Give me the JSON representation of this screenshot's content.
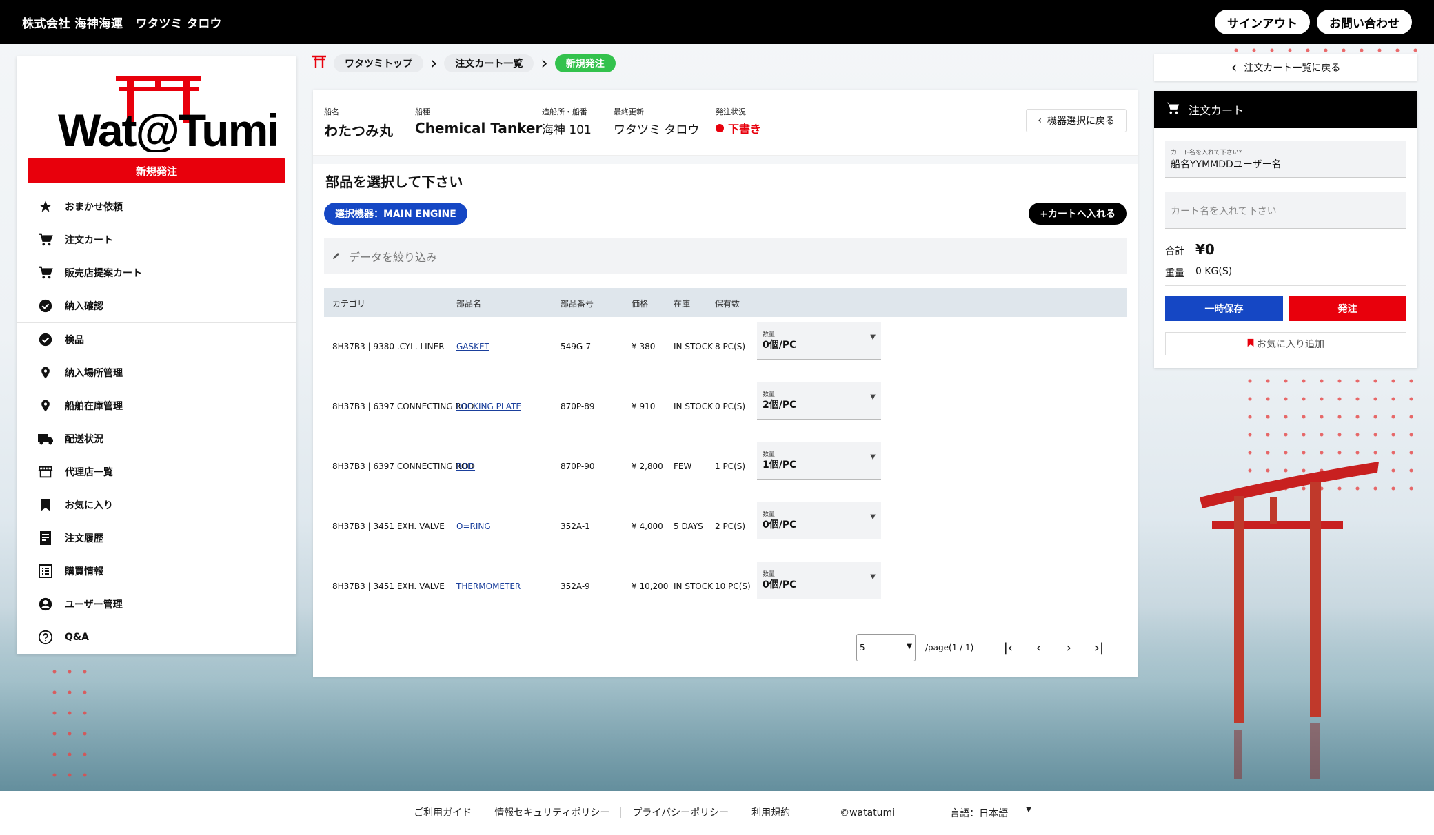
{
  "header": {
    "company": "株式会社 海神海運",
    "user": "ワタツミ タロウ",
    "signout_label": "サインアウト",
    "contact_label": "お問い合わせ"
  },
  "sidebar": {
    "new_order_label": "新規発注",
    "items": [
      {
        "label": "おまかせ依頼",
        "icon": "star-icon"
      },
      {
        "label": "注文カート",
        "icon": "cart-icon"
      },
      {
        "label": "販売店提案カート",
        "icon": "cart-icon"
      },
      {
        "label": "納入確認",
        "icon": "check-circle-icon"
      },
      {
        "label": "検品",
        "icon": "check-circle-icon"
      },
      {
        "label": "納入場所管理",
        "icon": "location-pin-icon"
      },
      {
        "label": "船舶在庫管理",
        "icon": "location-pin-icon"
      },
      {
        "label": "配送状況",
        "icon": "truck-icon"
      },
      {
        "label": "代理店一覧",
        "icon": "store-icon"
      },
      {
        "label": "お気に入り",
        "icon": "bookmark-icon"
      },
      {
        "label": "注文履歴",
        "icon": "receipt-icon"
      },
      {
        "label": "購買情報",
        "icon": "list-icon"
      },
      {
        "label": "ユーザー管理",
        "icon": "user-circle-icon"
      },
      {
        "label": "Q&A",
        "icon": "help-circle-icon"
      }
    ]
  },
  "breadcrumb": {
    "home": "ワタツミトップ",
    "cart_list": "注文カート一覧",
    "current": "新規発注"
  },
  "ship": {
    "name_label": "船名",
    "name": "わたつみ丸",
    "type_label": "船種",
    "type": "Chemical Tanker",
    "yard_label": "造船所・船番",
    "yard": "海神 101",
    "updated_label": "最終更新",
    "updated": "ワタツミ タロウ",
    "status_label": "発注状況",
    "status": "下書き",
    "back_label": "機器選択に戻る"
  },
  "parts": {
    "title": "部品を選択して下さい",
    "equipment": "選択機器：MAIN ENGINE",
    "add_cart_label": "+カートへ入れる",
    "filter_placeholder": "データを絞り込み",
    "columns": [
      "カテゴリ",
      "部品名",
      "部品番号",
      "価格",
      "在庫",
      "保有数"
    ],
    "qty_label": "数量",
    "rows": [
      {
        "category": "8H37B3 | 9380 .CYL. LINER",
        "name": "GASKET",
        "number": "549G-7",
        "price": "¥ 380",
        "stock": "IN STOCK",
        "owned": "8 PC(S)",
        "qty": "0個/PC"
      },
      {
        "category": "8H37B3 | 6397 CONNECTING ROD",
        "name": "LOCKING PLATE",
        "number": "870P-89",
        "price": "¥ 910",
        "stock": "IN STOCK",
        "owned": "0 PC(S)",
        "qty": "2個/PC"
      },
      {
        "category": "8H37B3 | 6397 CONNECTING ROD",
        "name": "ROD",
        "number": "870P-90",
        "price": "¥ 2,800",
        "stock": "FEW",
        "owned": "1 PC(S)",
        "qty": "1個/PC"
      },
      {
        "category": "8H37B3 | 3451 EXH. VALVE",
        "name": "O=RING",
        "number": "352A-1",
        "price": "¥ 4,000",
        "stock": "5 DAYS",
        "owned": "2 PC(S)",
        "qty": "0個/PC"
      },
      {
        "category": "8H37B3 | 3451 EXH. VALVE",
        "name": "THERMOMETER",
        "number": "352A-9",
        "price": "¥ 10,200",
        "stock": "IN STOCK",
        "owned": "10 PC(S)",
        "qty": "0個/PC"
      }
    ],
    "per_page": "5",
    "page_text": "/page(1 / 1)"
  },
  "cart": {
    "back_link": "注文カート一覧に戻る",
    "title": "注文カート",
    "name_field_label": "カート名を入れて下さい*",
    "name_field_value": "船名YYMMDDユーザー名",
    "name_field2_placeholder": "カート名を入れて下さい",
    "total_label": "合計",
    "total_value": "¥0",
    "weight_label": "重量",
    "weight_value": "0 KG(S)",
    "save_label": "一時保存",
    "order_label": "発注",
    "favorite_label": "お気に入り追加"
  },
  "footer": {
    "links": [
      "ご利用ガイド",
      "情報セキュリティポリシー",
      "プライバシーポリシー",
      "利用規約"
    ],
    "copyright": "©watatumi",
    "language": "言語：日本語"
  },
  "colors": {
    "brand_red": "#e8000c",
    "brand_blue": "#1547c4",
    "active_green": "#33c24d"
  }
}
